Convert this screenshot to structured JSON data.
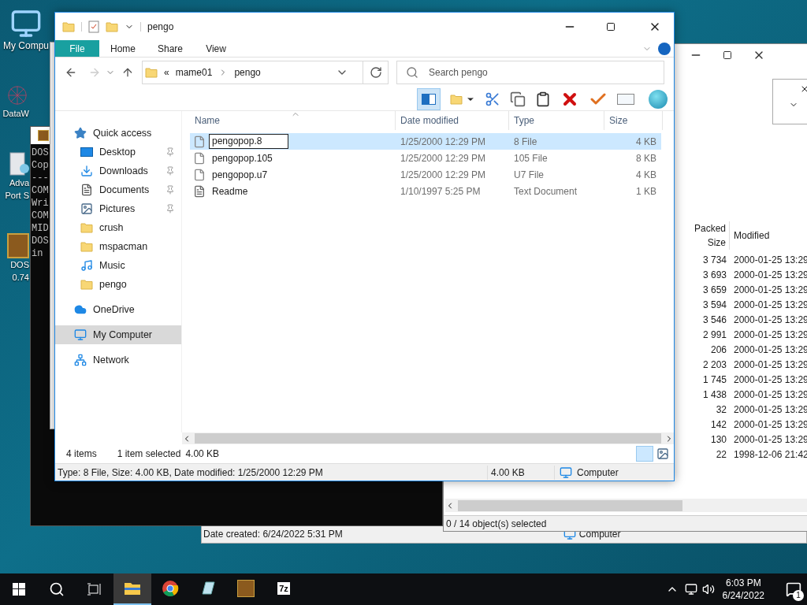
{
  "desktop_icons": [
    {
      "label": "My Compu",
      "kind": "computer"
    },
    {
      "label": "DataW",
      "kind": "molecule"
    },
    {
      "label": "Adva\nPort S",
      "kind": "server"
    },
    {
      "label": "DOS\n0.74",
      "kind": "dosbox"
    }
  ],
  "dosbox": {
    "lines": [
      "DOS",
      "Cop",
      "---",
      "COM",
      "Wri",
      "COM",
      "MID",
      "DOS",
      "in"
    ]
  },
  "archive_window": {
    "columns": [
      "Packed Size",
      "Modified"
    ],
    "rows": [
      [
        "3 734",
        "2000-01-25 13:29"
      ],
      [
        "3 693",
        "2000-01-25 13:29"
      ],
      [
        "3 659",
        "2000-01-25 13:29"
      ],
      [
        "3 594",
        "2000-01-25 13:29"
      ],
      [
        "3 546",
        "2000-01-25 13:29"
      ],
      [
        "2 991",
        "2000-01-25 13:29"
      ],
      [
        "206",
        "2000-01-25 13:29"
      ],
      [
        "2 203",
        "2000-01-25 13:29"
      ],
      [
        "1 745",
        "2000-01-25 13:29"
      ],
      [
        "1 438",
        "2000-01-25 13:29"
      ],
      [
        "32",
        "2000-01-25 13:29"
      ],
      [
        "142",
        "2000-01-25 13:29"
      ],
      [
        "130",
        "2000-01-25 13:29"
      ],
      [
        "22",
        "1998-12-06 21:42"
      ]
    ],
    "status": "0 / 14 object(s) selected"
  },
  "back_window": {
    "date_created": "Date created: 6/24/2022 5:31 PM",
    "location": "Computer"
  },
  "explorer": {
    "title": "pengo",
    "ribbon_tabs": [
      {
        "label": "File",
        "selected": true
      },
      {
        "label": "Home",
        "selected": false
      },
      {
        "label": "Share",
        "selected": false
      },
      {
        "label": "View",
        "selected": false
      }
    ],
    "breadcrumb": [
      "«",
      "mame01",
      "pengo"
    ],
    "search": {
      "placeholder": "Search pengo"
    },
    "nav": [
      {
        "label": "Quick access",
        "kind": "star",
        "selected": false,
        "children": [
          {
            "label": "Desktop",
            "kind": "desktop",
            "pinned": true,
            "selected": false
          },
          {
            "label": "Downloads",
            "kind": "download",
            "pinned": true,
            "selected": false
          },
          {
            "label": "Documents",
            "kind": "document",
            "pinned": true,
            "selected": false
          },
          {
            "label": "Pictures",
            "kind": "pictures",
            "pinned": true,
            "selected": false
          },
          {
            "label": "crush",
            "kind": "folder",
            "pinned": false,
            "selected": false
          },
          {
            "label": "mspacman",
            "kind": "folder",
            "pinned": false,
            "selected": false
          },
          {
            "label": "Music",
            "kind": "music",
            "pinned": false,
            "selected": false
          },
          {
            "label": "pengo",
            "kind": "folder",
            "pinned": false,
            "selected": false
          }
        ]
      },
      {
        "label": "OneDrive",
        "kind": "cloud",
        "selected": false
      },
      {
        "label": "My Computer",
        "kind": "computer",
        "selected": true
      },
      {
        "label": "Network",
        "kind": "network",
        "selected": false
      }
    ],
    "columns": [
      "Name",
      "Date modified",
      "Type",
      "Size"
    ],
    "files": [
      {
        "name": "pengopop.8",
        "date": "1/25/2000 12:29 PM",
        "type": "8 File",
        "size": "4 KB",
        "kind": "file",
        "selected": true,
        "renaming": true
      },
      {
        "name": "pengopop.105",
        "date": "1/25/2000 12:29 PM",
        "type": "105 File",
        "size": "8 KB",
        "kind": "file",
        "selected": false,
        "renaming": false
      },
      {
        "name": "pengopop.u7",
        "date": "1/25/2000 12:29 PM",
        "type": "U7 File",
        "size": "4 KB",
        "kind": "file",
        "selected": false,
        "renaming": false
      },
      {
        "name": "Readme",
        "date": "1/10/1997 5:25 PM",
        "type": "Text Document",
        "size": "1 KB",
        "kind": "text",
        "selected": false,
        "renaming": false
      }
    ],
    "status": {
      "count": "4 items",
      "selection": "1 item selected",
      "selection_size": "4.00 KB"
    },
    "details": {
      "text": "Type: 8 File, Size: 4.00 KB, Date modified: 1/25/2000 12:29 PM",
      "size": "4.00 KB",
      "location": "Computer"
    }
  },
  "taskbar": {
    "apps": [
      {
        "kind": "explorer",
        "selected": true
      },
      {
        "kind": "chrome",
        "selected": false
      },
      {
        "kind": "notepad",
        "selected": false
      },
      {
        "kind": "dosbox",
        "selected": false
      },
      {
        "kind": "archive",
        "label": "7z",
        "selected": false
      }
    ],
    "time": "6:03 PM",
    "date": "6/24/2022",
    "notifications": "1"
  }
}
